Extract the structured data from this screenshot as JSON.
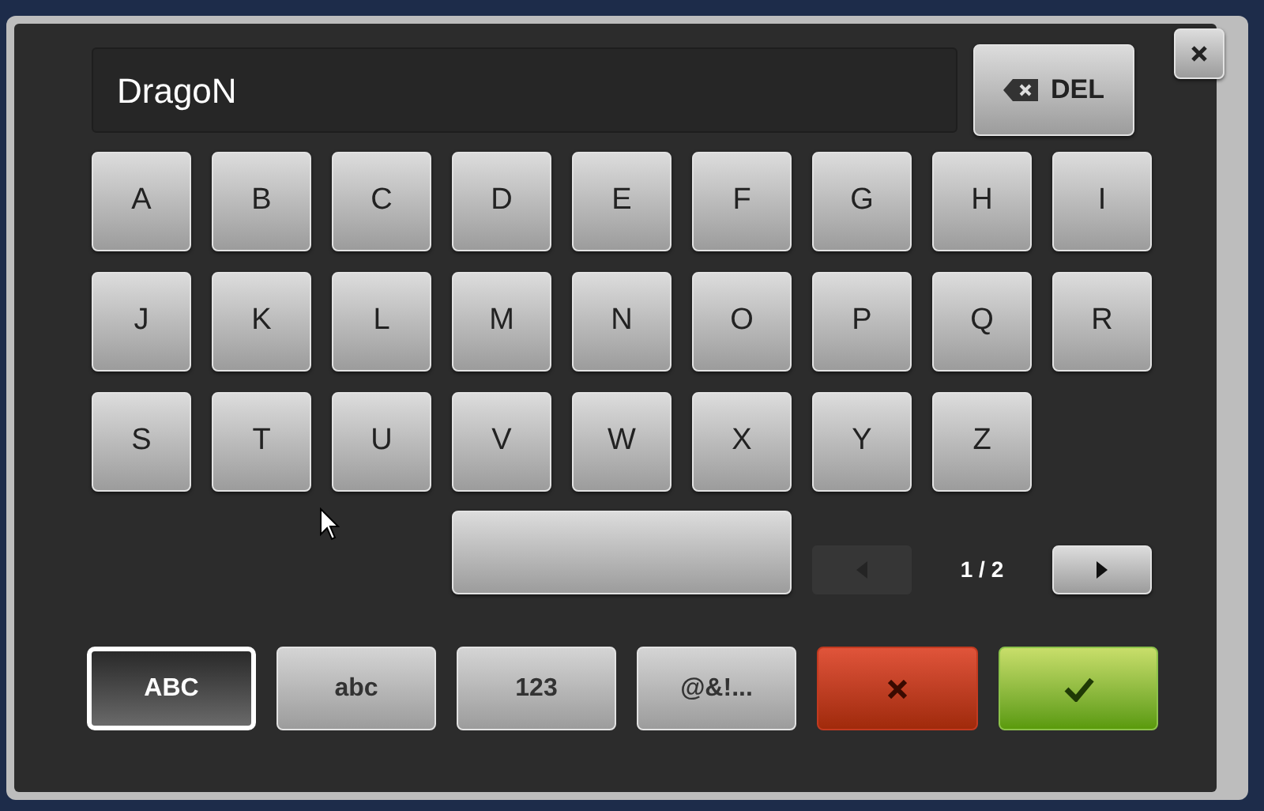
{
  "input": {
    "value": "DragoN"
  },
  "delete_button": {
    "label": "DEL"
  },
  "keys": [
    [
      "A",
      "B",
      "C",
      "D",
      "E",
      "F",
      "G",
      "H",
      "I"
    ],
    [
      "J",
      "K",
      "L",
      "M",
      "N",
      "O",
      "P",
      "Q",
      "R"
    ],
    [
      "S",
      "T",
      "U",
      "V",
      "W",
      "X",
      "Y",
      "Z"
    ]
  ],
  "pager": {
    "text": "1 / 2",
    "prev_disabled": true,
    "next_disabled": false
  },
  "modes": [
    {
      "label": "ABC",
      "selected": true
    },
    {
      "label": "abc",
      "selected": false
    },
    {
      "label": "123",
      "selected": false
    },
    {
      "label": "@&!...",
      "selected": false
    }
  ]
}
